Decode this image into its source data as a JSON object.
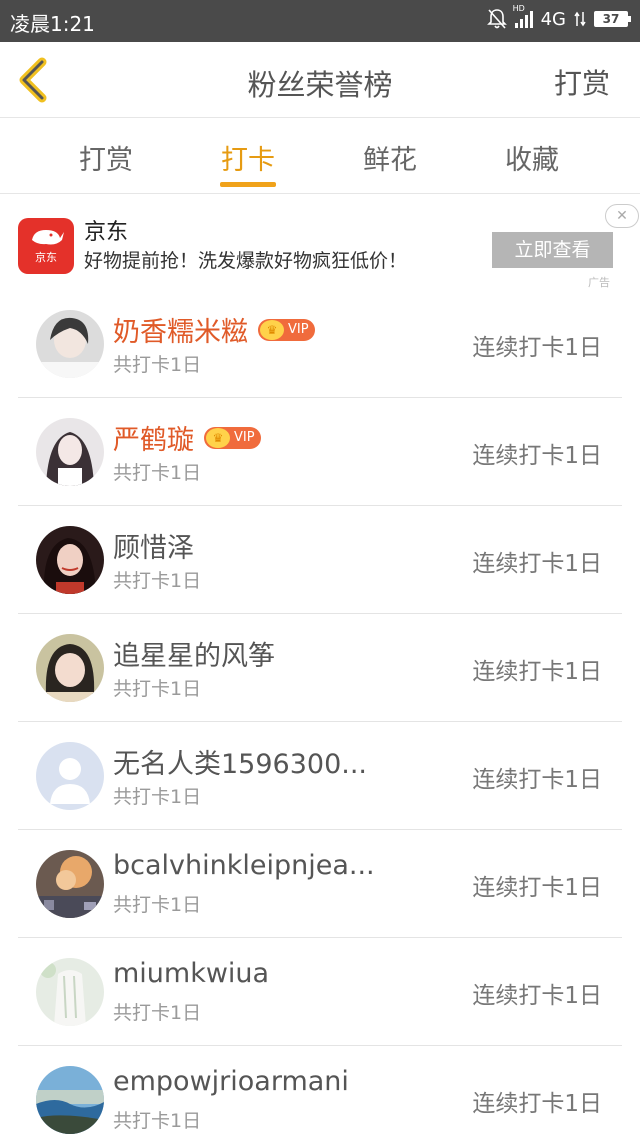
{
  "status_bar": {
    "time": "凌晨1:21",
    "hd": "HD",
    "network": "4G",
    "battery": "37"
  },
  "nav": {
    "title": "粉丝荣誉榜",
    "action": "打赏"
  },
  "tabs": [
    {
      "label": "打赏"
    },
    {
      "label": "打卡"
    },
    {
      "label": "鲜花"
    },
    {
      "label": "收藏"
    }
  ],
  "active_tab": "打卡",
  "ad": {
    "logo_text": "京东",
    "title": "京东",
    "description": "好物提前抢！洗发爆款好物疯狂低价！",
    "button": "立即查看",
    "close": "✕",
    "tag": "广告"
  },
  "vip_label": "VIP",
  "list": [
    {
      "name": "奶香糯米糍",
      "vip": true,
      "total": "共打卡1日",
      "streak": "连续打卡1日"
    },
    {
      "name": "严鹤璇",
      "vip": true,
      "total": "共打卡1日",
      "streak": "连续打卡1日"
    },
    {
      "name": "顾惜泽",
      "vip": false,
      "total": "共打卡1日",
      "streak": "连续打卡1日"
    },
    {
      "name": "追星星的风筝",
      "vip": false,
      "total": "共打卡1日",
      "streak": "连续打卡1日"
    },
    {
      "name": "无名人类1596300...",
      "vip": false,
      "total": "共打卡1日",
      "streak": "连续打卡1日"
    },
    {
      "name": "bcalvhinkleipnjea...",
      "vip": false,
      "total": "共打卡1日",
      "streak": "连续打卡1日"
    },
    {
      "name": "miumkwiua",
      "vip": false,
      "total": "共打卡1日",
      "streak": "连续打卡1日"
    },
    {
      "name": "empowjrioarmani",
      "vip": false,
      "total": "共打卡1日",
      "streak": "连续打卡1日"
    }
  ],
  "colors": {
    "accent": "#f0a21a",
    "vip_name": "#e05a28",
    "status_bar": "#4a4a4a"
  }
}
